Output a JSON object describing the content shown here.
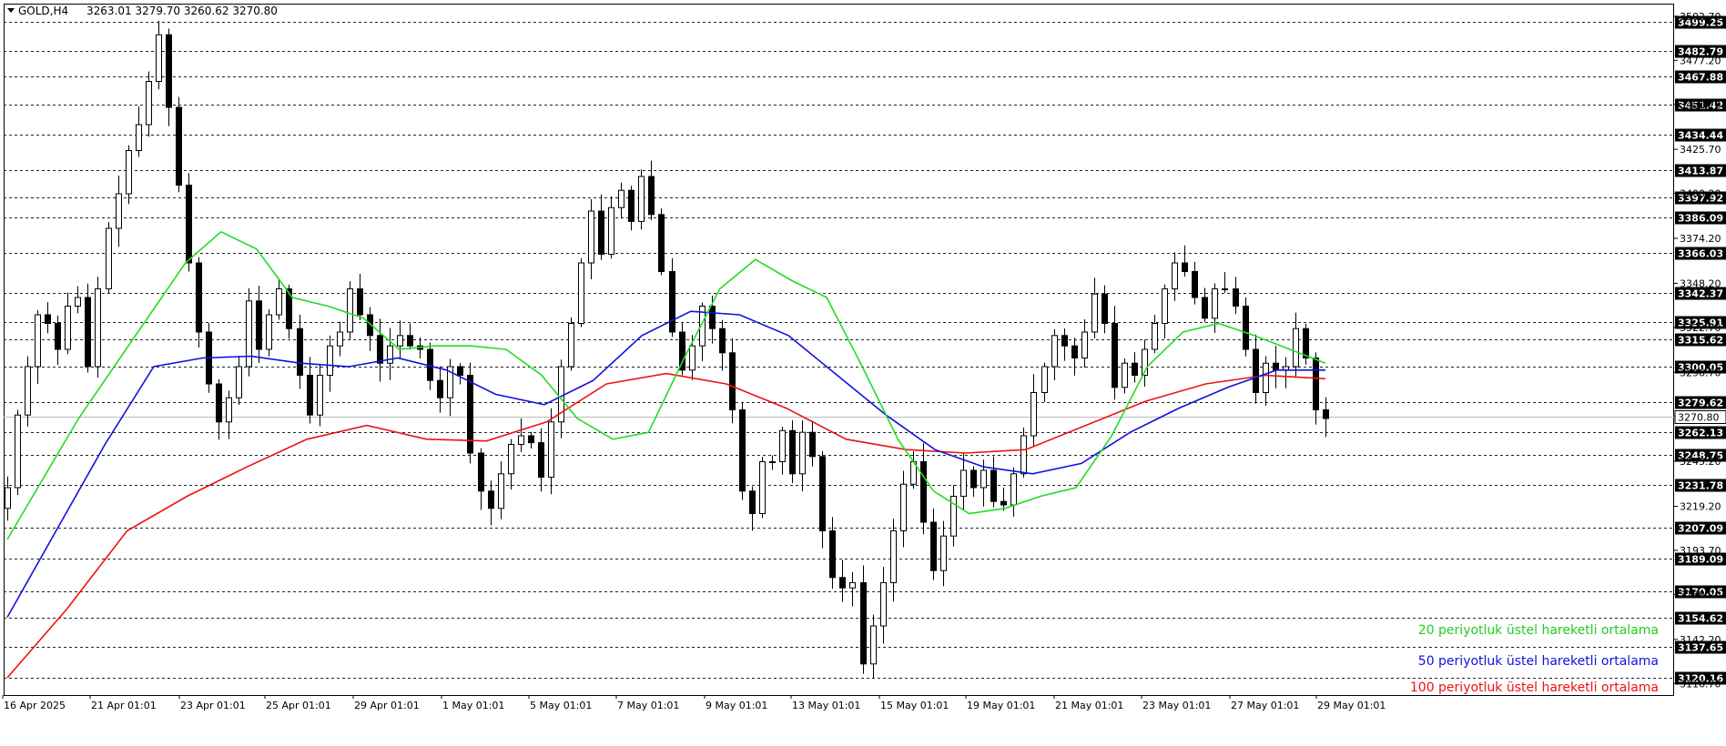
{
  "header": {
    "symbol": "GOLD,H4",
    "ohlc": "3263.01 3279.70 3260.62 3270.80"
  },
  "colors": {
    "ema20": "#22dd22",
    "ema50": "#1111dd",
    "ema100": "#ee1111",
    "bull_candle": "#ffffff",
    "bear_candle": "#000000",
    "level_box": "#000000"
  },
  "chart_data": {
    "type": "candlestick",
    "y_range": [
      3110,
      3510
    ],
    "grid": "horizontal dashed at marked levels",
    "legend_placement": "bottom-right",
    "x_labels": [
      "16 Apr 2025",
      "21 Apr 01:01",
      "23 Apr 01:01",
      "25 Apr 01:01",
      "29 Apr 01:01",
      "1 May 01:01",
      "5 May 01:01",
      "7 May 01:01",
      "9 May 01:01",
      "13 May 01:01",
      "15 May 01:01",
      "19 May 01:01",
      "21 May 01:01",
      "23 May 01:01",
      "27 May 01:01",
      "29 May 01:01"
    ],
    "price_ticks": [
      "3502.70",
      "3477.20",
      "3451.70",
      "3425.70",
      "3400.20",
      "3374.20",
      "3348.20",
      "3322.70",
      "3296.70",
      "3271.20",
      "3245.20",
      "3219.20",
      "3193.70",
      "3168.20",
      "3142.20",
      "3116.70"
    ],
    "levels": [
      "3499.25",
      "3482.79",
      "3467.88",
      "3451.42",
      "3434.44",
      "3413.87",
      "3397.92",
      "3386.09",
      "3366.03",
      "3342.37",
      "3325.91",
      "3315.62",
      "3300.05",
      "3279.62",
      "3262.13",
      "3248.75",
      "3231.78",
      "3207.09",
      "3189.09",
      "3170.05",
      "3154.62",
      "3137.65",
      "3120.16"
    ],
    "current_price": "3270.80",
    "series": [
      {
        "name": "20 periyotluk üstel hareketli ortalama",
        "color": "#22dd22"
      },
      {
        "name": "50 periyotluk üstel hareketli ortalama",
        "color": "#1111dd"
      },
      {
        "name": "100 periyotluk üstel hareketli ortalama",
        "color": "#ee1111"
      }
    ],
    "close_path": [
      3230,
      3272,
      3300,
      3330,
      3325,
      3310,
      3335,
      3340,
      3300,
      3345,
      3380,
      3400,
      3425,
      3440,
      3465,
      3492,
      3450,
      3405,
      3360,
      3320,
      3290,
      3268,
      3282,
      3300,
      3338,
      3310,
      3330,
      3345,
      3322,
      3295,
      3272,
      3295,
      3312,
      3320,
      3345,
      3330,
      3318,
      3302,
      3312,
      3318,
      3312,
      3310,
      3292,
      3282,
      3300,
      3295,
      3250,
      3228,
      3218,
      3238,
      3255,
      3260,
      3256,
      3236,
      3268,
      3300,
      3325,
      3360,
      3390,
      3365,
      3392,
      3402,
      3384,
      3410,
      3388,
      3355,
      3320,
      3298,
      3312,
      3335,
      3322,
      3308,
      3275,
      3228,
      3215,
      3245,
      3245,
      3263,
      3238,
      3262,
      3248,
      3205,
      3178,
      3172,
      3175,
      3128,
      3150,
      3175,
      3205,
      3232,
      3245,
      3210,
      3182,
      3202,
      3225,
      3240,
      3230,
      3240,
      3222,
      3220,
      3238,
      3260,
      3285,
      3300,
      3318,
      3312,
      3305,
      3320,
      3342,
      3325,
      3288,
      3302,
      3295,
      3310,
      3325,
      3345,
      3360,
      3355,
      3340,
      3328,
      3345,
      3345,
      3335,
      3310,
      3285,
      3302,
      3298,
      3300,
      3322,
      3305,
      3275,
      3270
    ],
    "ema20_path": [
      3200,
      3235,
      3270,
      3300,
      3330,
      3360,
      3378,
      3368,
      3340,
      3335,
      3328,
      3310,
      3312,
      3312,
      3310,
      3295,
      3270,
      3258,
      3262,
      3305,
      3345,
      3362,
      3350,
      3340,
      3300,
      3258,
      3228,
      3215,
      3218,
      3225,
      3230,
      3260,
      3300,
      3320,
      3325,
      3318,
      3310,
      3302
    ],
    "ema50_path": [
      3155,
      3205,
      3255,
      3300,
      3305,
      3306,
      3302,
      3300,
      3305,
      3298,
      3284,
      3278,
      3292,
      3318,
      3332,
      3330,
      3318,
      3295,
      3272,
      3252,
      3242,
      3238,
      3244,
      3262,
      3276,
      3288,
      3298,
      3298
    ],
    "ema100_path": [
      3120,
      3160,
      3205,
      3225,
      3242,
      3258,
      3266,
      3258,
      3257,
      3268,
      3290,
      3296,
      3290,
      3276,
      3258,
      3252,
      3250,
      3252,
      3266,
      3280,
      3290,
      3295,
      3293
    ]
  }
}
